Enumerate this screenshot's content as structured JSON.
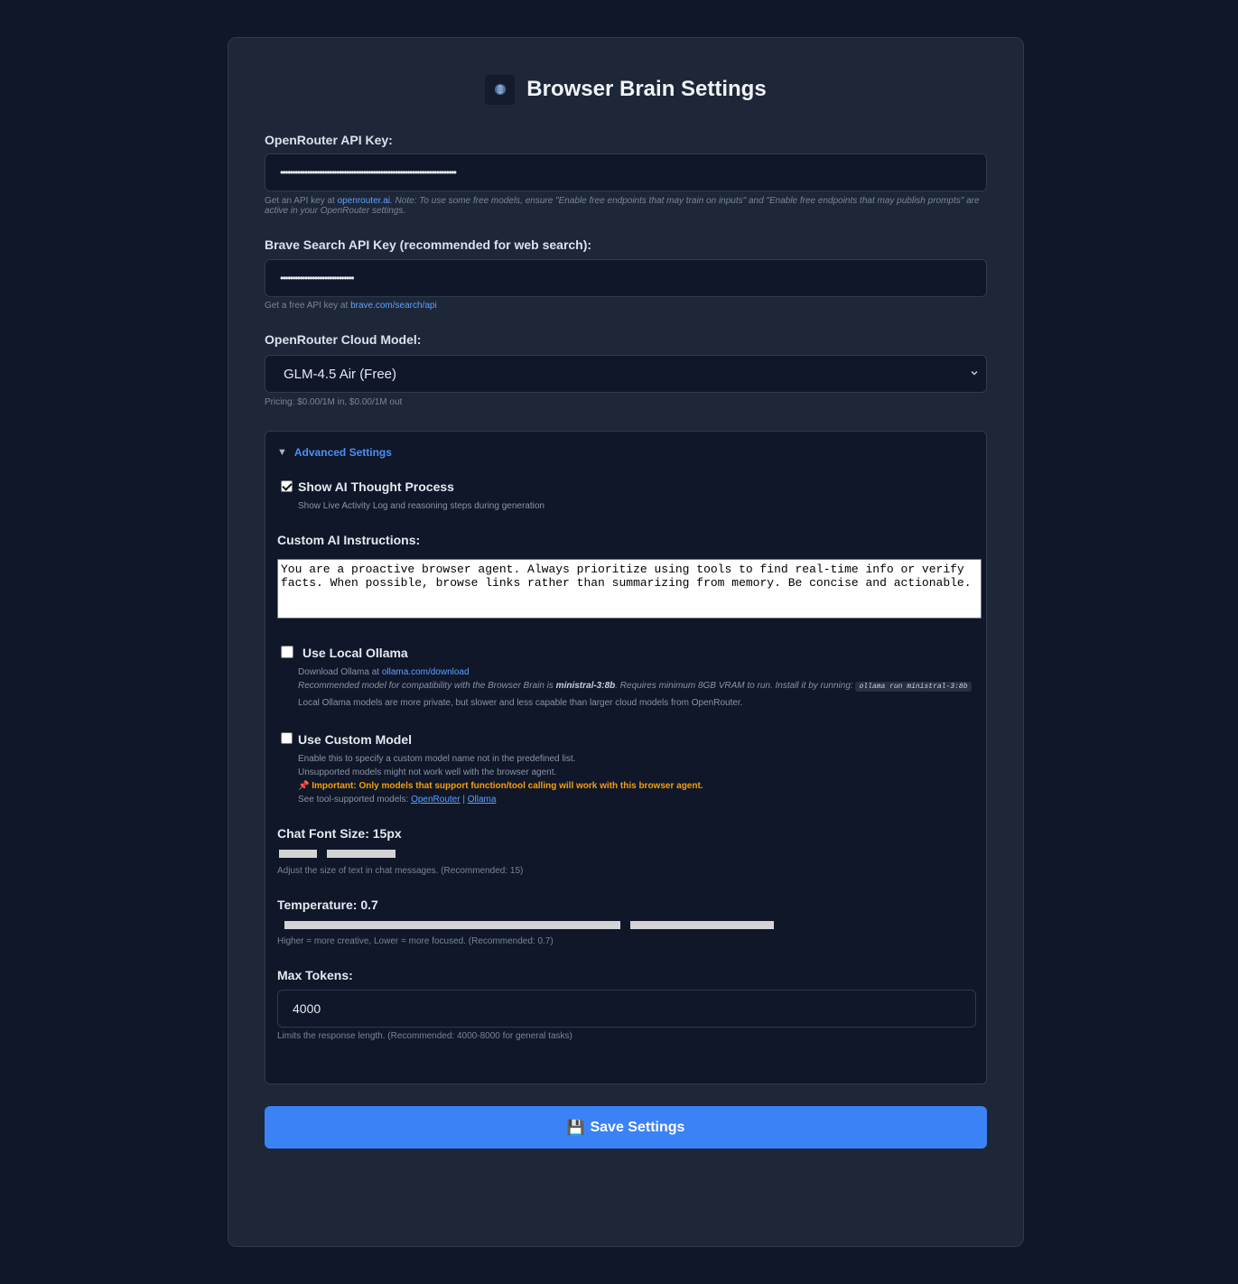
{
  "header": {
    "title": "Browser Brain Settings",
    "logo_icon": "brain-icon"
  },
  "openrouter_key": {
    "label": "OpenRouter API Key:",
    "value": "••••••••••••••••••••••••••••••••••••••••••••••••••••••••••••••••••••••••",
    "hint_prefix": "Get an API key at ",
    "hint_link": "openrouter.ai",
    "hint_note": ". Note: To use some free models, ensure \"Enable free endpoints that may train on inputs\" and \"Enable free endpoints that may publish prompts\" are active in your OpenRouter settings."
  },
  "brave_key": {
    "label": "Brave Search API Key (recommended for web search):",
    "value": "••••••••••••••••••••••••••••••",
    "hint_prefix": "Get a free API key at ",
    "hint_link": "brave.com/search/api"
  },
  "cloud_model": {
    "label": "OpenRouter Cloud Model:",
    "selected": "GLM-4.5 Air (Free)",
    "pricing": "Pricing: $0.00/1M in, $0.00/1M out"
  },
  "advanced": {
    "summary": "Advanced Settings",
    "show_thought": {
      "label": "Show AI Thought Process",
      "checked": true,
      "hint": "Show Live Activity Log and reasoning steps during generation"
    },
    "custom_instructions": {
      "label": "Custom AI Instructions:",
      "value": "You are a proactive browser agent. Always prioritize using tools to find real-time info or verify facts. When possible, browse links rather than summarizing from memory. Be concise and actionable."
    },
    "local_ollama": {
      "label": "Use Local Ollama",
      "checked": false,
      "download_prefix": "Download Ollama at ",
      "download_link": "ollama.com/download",
      "rec_prefix": "Recommended model for compatibility with the Browser Brain is ",
      "rec_model": "ministral-3:8b",
      "rec_suffix": ". Requires minimum 8GB VRAM to run. Install it by running: ",
      "install_cmd": "ollama run ministral-3:8b",
      "privacy_note": "Local Ollama models are more private, but slower and less capable than larger cloud models from OpenRouter."
    },
    "custom_model": {
      "label": "Use Custom Model",
      "checked": false,
      "line1": "Enable this to specify a custom model name not in the predefined list.",
      "line2": "Unsupported models might not work well with the browser agent.",
      "important": "📌 Important: Only models that support function/tool calling will work with this browser agent.",
      "see_prefix": "See tool-supported models: ",
      "link_openrouter": "OpenRouter",
      "separator": " | ",
      "link_ollama": "Ollama"
    },
    "font_size": {
      "label": "Chat Font Size: 15px",
      "value": 15,
      "min": 10,
      "max": 24,
      "hint": "Adjust the size of text in chat messages. (Recommended: 15)"
    },
    "temperature": {
      "label": "Temperature: 0.7",
      "value": 0.7,
      "min": 0,
      "max": 1,
      "hint": "Higher = more creative, Lower = more focused. (Recommended: 0.7)"
    },
    "max_tokens": {
      "label": "Max Tokens:",
      "value": "4000",
      "hint": "Limits the response length. (Recommended: 4000-8000 for general tasks)"
    }
  },
  "save": {
    "icon": "floppy-disk-icon",
    "emoji": "💾",
    "label": "Save Settings"
  },
  "colors": {
    "page_bg": "#0f1729",
    "card_bg": "#1d2738",
    "accent": "#3b82f6",
    "link": "#5ea1ff",
    "warning": "#f59e0b"
  }
}
